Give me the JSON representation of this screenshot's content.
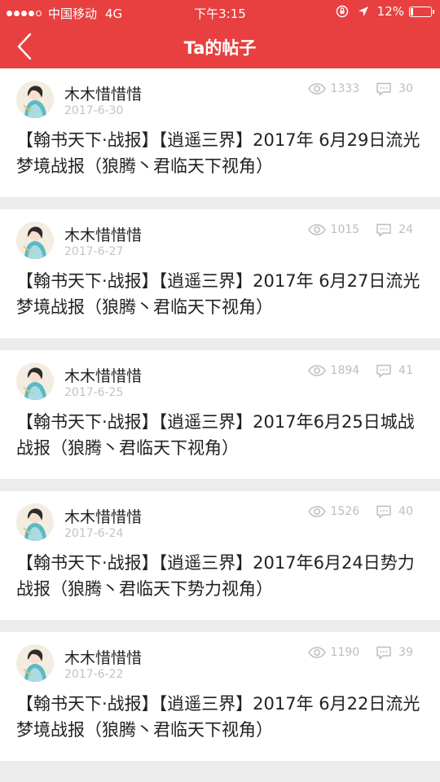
{
  "status_bar": {
    "carrier": "中国移动",
    "network": "4G",
    "time": "下午3:15",
    "battery_percent": "12%",
    "battery_level": 0.12,
    "signal_bars": 4,
    "signal_total": 5
  },
  "nav": {
    "title": "Ta的帖子",
    "back_icon": "chevron-left-icon"
  },
  "colors": {
    "brand_red": "#e84040",
    "divider": "#ececec",
    "muted_text": "#c3c3c3"
  },
  "posts": [
    {
      "author": "木木惜惜惜",
      "date": "2017-6-30",
      "views": "1333",
      "comments": "30",
      "title": "【翰书天下·战报】【逍遥三界】2017年 6月29日流光梦境战报（狼腾丶君临天下视角）"
    },
    {
      "author": "木木惜惜惜",
      "date": "2017-6-27",
      "views": "1015",
      "comments": "24",
      "title": "【翰书天下·战报】【逍遥三界】2017年 6月27日流光梦境战报（狼腾丶君临天下视角）"
    },
    {
      "author": "木木惜惜惜",
      "date": "2017-6-25",
      "views": "1894",
      "comments": "41",
      "title": "【翰书天下·战报】【逍遥三界】2017年6月25日城战战报（狼腾丶君临天下视角）"
    },
    {
      "author": "木木惜惜惜",
      "date": "2017-6-24",
      "views": "1526",
      "comments": "40",
      "title": "【翰书天下·战报】【逍遥三界】2017年6月24日势力战报（狼腾丶君临天下势力视角）"
    },
    {
      "author": "木木惜惜惜",
      "date": "2017-6-22",
      "views": "1190",
      "comments": "39",
      "title": "【翰书天下·战报】【逍遥三界】2017年 6月22日流光梦境战报（狼腾丶君临天下视角）"
    }
  ]
}
